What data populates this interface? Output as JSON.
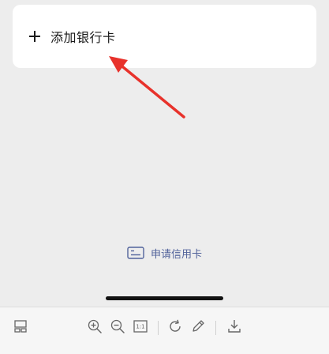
{
  "add_card": {
    "label": "添加银行卡"
  },
  "apply_link": {
    "label": "申请信用卡"
  },
  "toolbar": {
    "fit_label": "1:1"
  },
  "colors": {
    "background": "#ededed",
    "card": "#ffffff",
    "arrow": "#e8322b",
    "link": "#52639b",
    "toolbar_icon": "#666666"
  },
  "icons": {
    "add": "plus-icon",
    "apply": "credit-card-icon",
    "toolbar": [
      "layout-icon",
      "zoom-in-icon",
      "zoom-out-icon",
      "actual-size-icon",
      "rotate-icon",
      "edit-pencil-icon",
      "download-icon"
    ]
  }
}
